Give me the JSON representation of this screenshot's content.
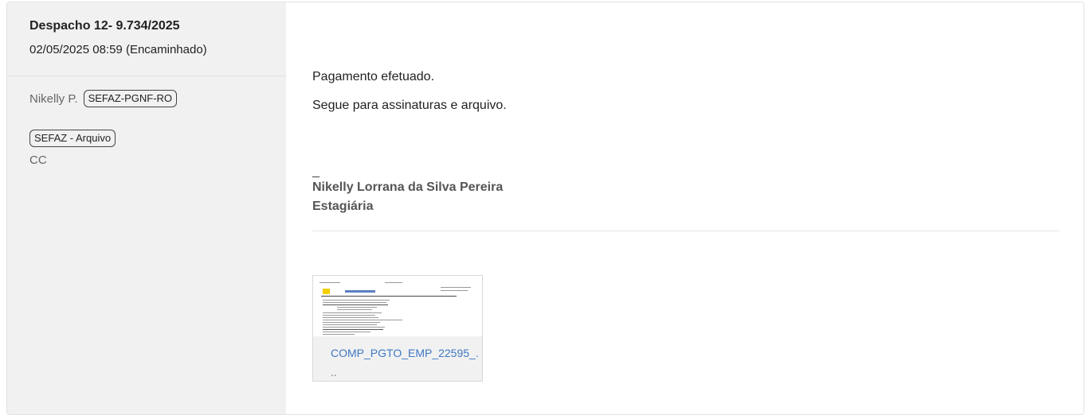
{
  "despacho": {
    "title": "Despacho 12- 9.734/2025",
    "datetime_status": "02/05/2025 08:59 (Encaminhado)",
    "sender_name": "Nikelly P.",
    "sender_tag": "SEFAZ-PGNF-RO",
    "recipient_tag": "SEFAZ - Arquivo",
    "cc_label": "CC"
  },
  "message": {
    "lines": [
      "Pagamento efetuado.",
      "Segue para assinaturas e arquivo."
    ],
    "signature_dash": "_",
    "signature_name": "Nikelly Lorrana da Silva Pereira",
    "signature_role": "Estagiária"
  },
  "attachment": {
    "filename": "COMP_PGTO_EMP_22595_.",
    "ellipsis": ".."
  }
}
